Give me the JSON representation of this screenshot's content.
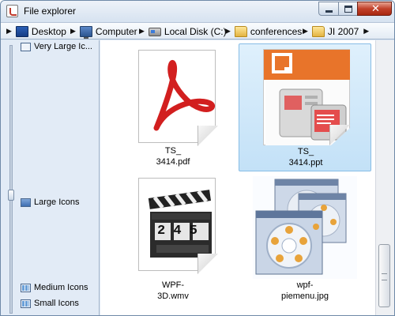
{
  "window": {
    "title": "File explorer"
  },
  "breadcrumb": [
    {
      "label": "Desktop",
      "icon": "desktop-icon"
    },
    {
      "label": "Computer",
      "icon": "computer-icon"
    },
    {
      "label": "Local Disk (C:)",
      "icon": "drive-icon"
    },
    {
      "label": "conferences",
      "icon": "folder-icon"
    },
    {
      "label": "JI 2007",
      "icon": "folder-icon"
    }
  ],
  "view_modes": [
    {
      "label": "Very Large Ic..."
    },
    {
      "label": "Large Icons"
    },
    {
      "label": "Medium Icons"
    },
    {
      "label": "Small Icons"
    }
  ],
  "view_level": 0.58,
  "files": [
    {
      "line1": "TS_",
      "line2": "3414.pdf",
      "icon": "pdf-icon",
      "selected": false
    },
    {
      "line1": "TS_",
      "line2": "3414.ppt",
      "icon": "powerpoint-icon",
      "selected": true
    },
    {
      "line1": "WPF-",
      "line2": "3D.wmv",
      "icon": "clapperboard-icon",
      "selected": false
    },
    {
      "line1": "wpf-",
      "line2": "piemenu.jpg",
      "icon": "image-thumbnail-icon",
      "selected": false
    }
  ],
  "clapper_digits": "2 4 5",
  "colors": {
    "selection": "#c3e1f7",
    "accent": "#1f5fbf",
    "pdf_red": "#d21f1f",
    "ppt_orange": "#e8742a"
  }
}
